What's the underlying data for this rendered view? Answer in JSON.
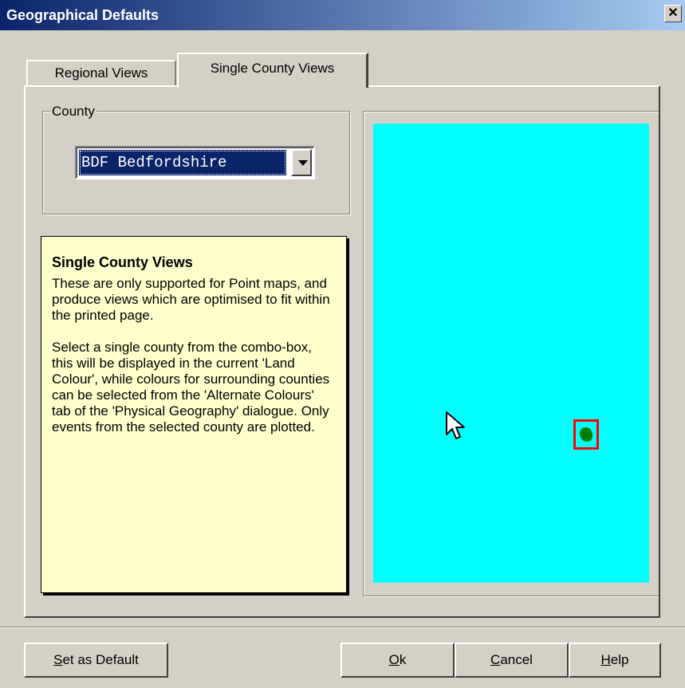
{
  "window": {
    "title": "Geographical Defaults",
    "close_glyph": "✕"
  },
  "tabs": [
    {
      "label": "Regional Views",
      "active": false
    },
    {
      "label": "Single County Views",
      "active": true
    }
  ],
  "county_group": {
    "label": "County",
    "selected_value": "BDF Bedfordshire"
  },
  "help": {
    "title": "Single County Views",
    "paragraphs": [
      "These are only supported for Point maps, and produce views which are optimised to fit within the printed page.",
      "Select a single county from the combo-box, this will be displayed in the current 'Land Colour', while colours for surrounding counties can be selected from the 'Alternate Colours' tab of the 'Physical Geography' dialogue.  Only events from the selected county are plotted."
    ]
  },
  "map": {
    "background_color": "#00ffff",
    "county_color": "#008000",
    "highlight_color": "#ff0000"
  },
  "buttons": {
    "set_default": "Set as Default",
    "ok": "Ok",
    "cancel": "Cancel",
    "help": "Help"
  }
}
